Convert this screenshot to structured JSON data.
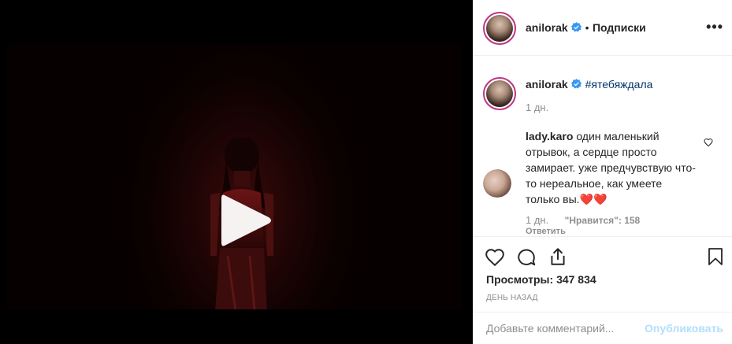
{
  "header": {
    "username": "anilorak",
    "separator": "•",
    "follow_label": "Подписки",
    "more_label": "•••"
  },
  "caption": {
    "username": "anilorak",
    "hashtag": "#ятебяждала",
    "time": "1 дн."
  },
  "comments": [
    {
      "username": "lady.karo",
      "text": "один маленький отрывок, а сердце просто замирает. уже предчувствую что-то нереальное, как умеете только вы.❤️❤️",
      "time": "1 дн.",
      "likes_label": "\"Нравится\": 158",
      "reply_label": "Ответить"
    }
  ],
  "stats": {
    "views_label": "Просмотры:",
    "views_value": "347 834",
    "date": "ДЕНЬ НАЗАД"
  },
  "add_comment": {
    "placeholder": "Добавьте комментарий...",
    "post_label": "Опубликовать"
  },
  "icons": {
    "heart": "heart-icon",
    "comment": "comment-icon",
    "share": "share-icon",
    "bookmark": "bookmark-icon",
    "verified": "verified-badge-icon",
    "play": "play-icon"
  },
  "colors": {
    "verified": "#3897f0",
    "link": "#003569",
    "post_button": "#b2dffc",
    "muted": "#8e8e8e"
  }
}
